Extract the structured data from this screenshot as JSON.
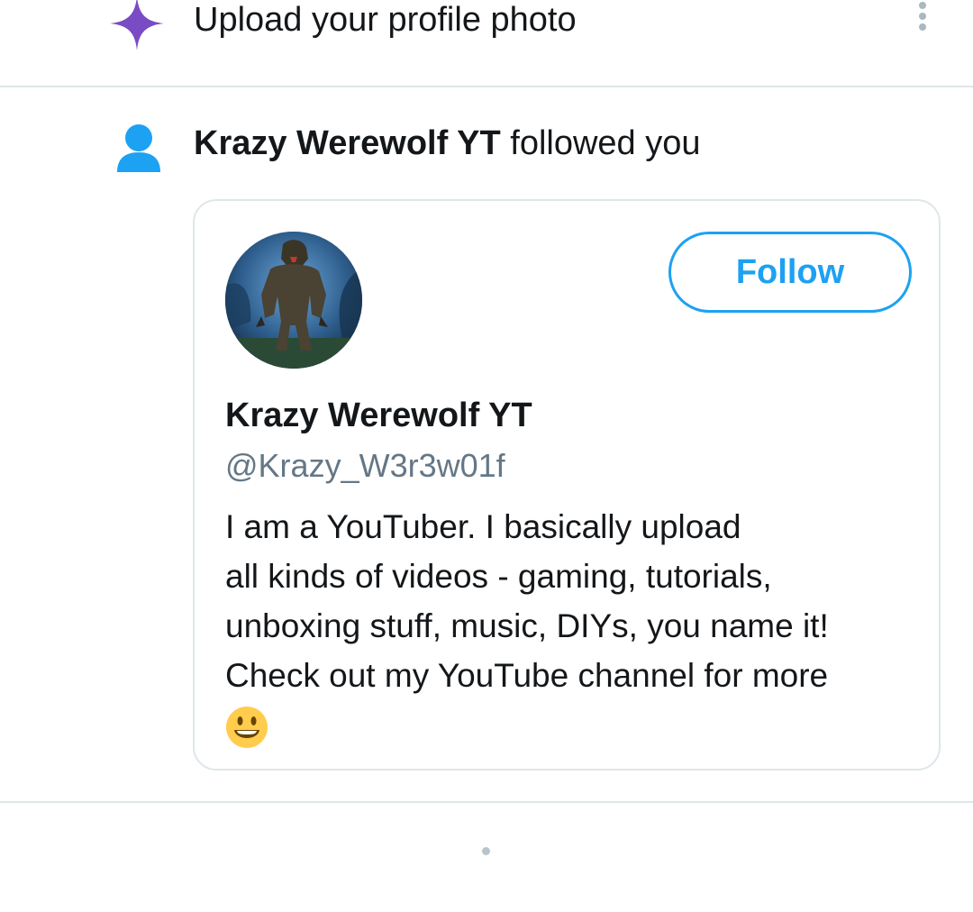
{
  "notifications": [
    {
      "type": "suggestion",
      "icon": "sparkle-icon",
      "text": "Upload your profile photo"
    },
    {
      "type": "follow",
      "icon": "person-icon",
      "actor_name": "Krazy Werewolf YT",
      "action_text": " followed you",
      "card": {
        "display_name": "Krazy Werewolf YT",
        "handle": "@Krazy_W3r3w01f",
        "follow_label": "Follow",
        "bio_lines": [
          "I am a YouTuber. I basically upload",
          "all kinds of videos - gaming, tutorials,",
          "unboxing stuff, music, DIYs, you name it!",
          "Check out my YouTube channel for more"
        ],
        "bio_emoji": "smiley-icon"
      }
    }
  ],
  "colors": {
    "accent": "#1da1f2",
    "sparkle": "#794bc4",
    "text_primary": "#14171a",
    "text_secondary": "#657786",
    "divider": "#dfe6ea"
  }
}
